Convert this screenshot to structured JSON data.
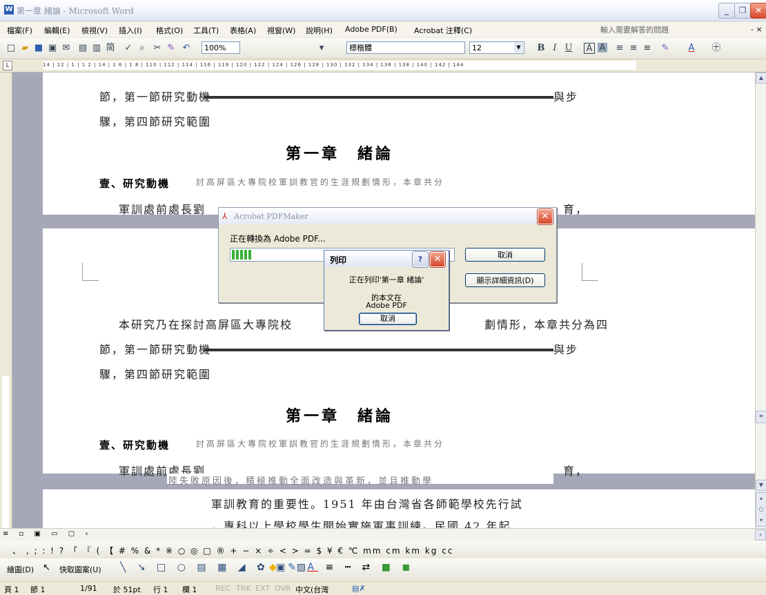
{
  "window": {
    "title": "第一章 緒論 - Microsoft Word",
    "minimize": "_",
    "restore": "❐",
    "close": "✕"
  },
  "menu": {
    "items": [
      "檔案(F)",
      "編輯(E)",
      "檢視(V)",
      "插入(I)",
      "格式(O)",
      "工具(T)",
      "表格(A)",
      "視窗(W)",
      "說明(H)",
      "Adobe PDF(B)",
      "Acrobat 注釋(C)"
    ],
    "help_placeholder": "輸入需要解答的問題",
    "close_doc": "- ×"
  },
  "toolbar": {
    "zoom": "100%",
    "style": "標楷體",
    "font_size": "12",
    "bold": "B",
    "italic": "I",
    "underline": "U"
  },
  "ruler": {
    "scale": "14 | 12 | 1 | 1 2 | 14 | 1 6 | 1 8 | 110 | 112 | 114 | 116 | 118 | 120 | 122 | 124 | 126 | 128 | 130 | 132 | 134 | 136 | 138 | 140 | 142 | 144"
  },
  "document": {
    "line_a": "節，第一節研究動機",
    "line_a_end": "與步",
    "line_b": "驟，第四節研究範圍",
    "chapter_title": "第一章　緒論",
    "section_1": "壹、研究動機",
    "garble_1": "討高屏區大專院校軍訓教官的生涯規劃情形，本章共分",
    "line_c": "軍訓處前處長劉",
    "line_c_end": "育，",
    "line_d": "本研究乃在探討高屏區大專院校",
    "line_d_end": "劃情形，本章共分為四",
    "line_e_mid": "陸失敗原因後，積極推動全面改造與革新，並且推動學",
    "line_f": "軍訓教育的重要性。1951 年由台灣省各師範學校先行試",
    "line_g": "，專科以上學校學生開始實施軍事訓練。民國 42 年起"
  },
  "pdfmaker": {
    "title": "Acrobat PDFMaker",
    "status": "正在轉換為 Adobe PDF...",
    "progress": 0.04,
    "cancel": "取消",
    "details": "顯示詳細資訊(D)"
  },
  "print_dialog": {
    "title": "列印",
    "line1": "正在列印'第一章 緒論'",
    "line2": "的本文在",
    "line3": "Adobe PDF",
    "cancel": "取消"
  },
  "symbols": "、 ,  ;  :  !  ?  「  『  (  【  #  %  &  *  ※  ○  ◎  □  ®  +  −  ×  ÷  <  >  =  $  ¥  €  ℃  mm  cm  km  kg  cc",
  "drawbar": {
    "draw": "繪圖(D)",
    "autoshapes": "快取圖案(U)"
  },
  "status": {
    "page": "頁 1",
    "section": "節 1",
    "pages": "1/91",
    "at": "於 51pt",
    "line": "行 1",
    "col": "欄 1",
    "rec": "REC",
    "trk": "TRK",
    "ext": "EXT",
    "ovr": "OVR",
    "lang": "中文(台灣"
  }
}
